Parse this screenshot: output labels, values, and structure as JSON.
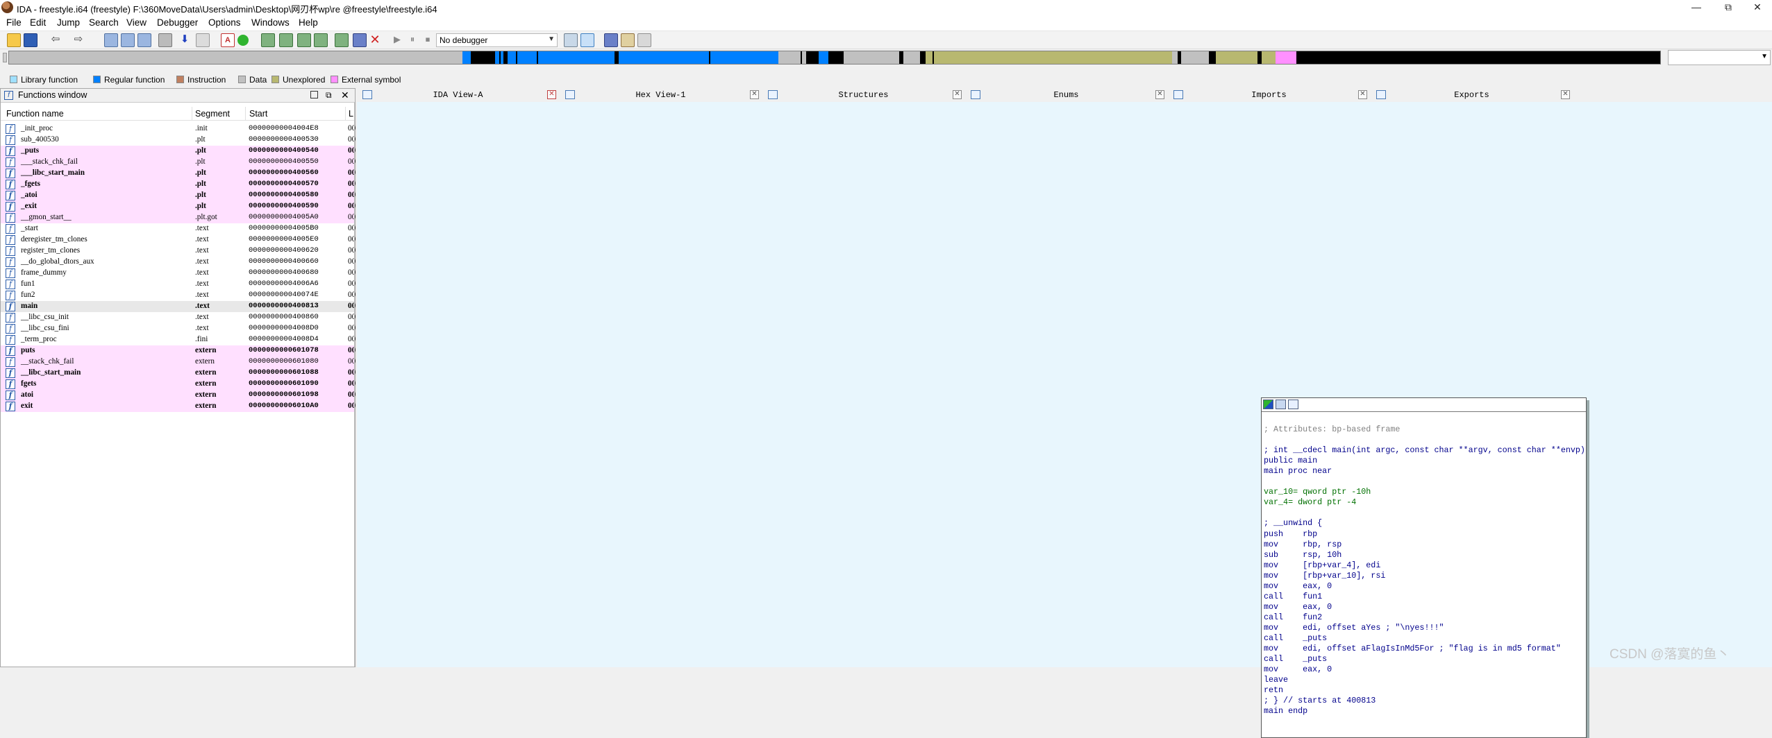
{
  "window": {
    "title": "IDA - freestyle.i64 (freestyle) F:\\360MoveData\\Users\\admin\\Desktop\\网刃杯wp\\re @freestyle\\freestyle.i64",
    "controls": [
      "—",
      "⧉",
      "✕"
    ]
  },
  "menu": [
    "File",
    "Edit",
    "Jump",
    "Search",
    "View",
    "Debugger",
    "Options",
    "Windows",
    "Help"
  ],
  "toolbar": {
    "debugger_select": "No debugger"
  },
  "legend": [
    {
      "label": "Library function",
      "color": "#a0e0ff"
    },
    {
      "label": "Regular function",
      "color": "#0080ff"
    },
    {
      "label": "Instruction",
      "color": "#c08060"
    },
    {
      "label": "Data",
      "color": "#c0c0c0"
    },
    {
      "label": "Unexplored",
      "color": "#b8b870"
    },
    {
      "label": "External symbol",
      "color": "#ff90ff"
    }
  ],
  "functions_window": {
    "title": "Functions window",
    "columns": [
      "Function name",
      "Segment",
      "Start",
      "L"
    ],
    "rows": [
      {
        "name": "_init_proc",
        "segment": ".init",
        "start": "00000000004004E8",
        "len": "00",
        "style": ""
      },
      {
        "name": "sub_400530",
        "segment": ".plt",
        "start": "0000000000400530",
        "len": "00",
        "style": ""
      },
      {
        "name": "_puts",
        "segment": ".plt",
        "start": "0000000000400540",
        "len": "00",
        "style": "pink bold"
      },
      {
        "name": "___stack_chk_fail",
        "segment": ".plt",
        "start": "0000000000400550",
        "len": "00",
        "style": "pink"
      },
      {
        "name": "___libc_start_main",
        "segment": ".plt",
        "start": "0000000000400560",
        "len": "00",
        "style": "pink bold"
      },
      {
        "name": "_fgets",
        "segment": ".plt",
        "start": "0000000000400570",
        "len": "00",
        "style": "pink bold"
      },
      {
        "name": "_atoi",
        "segment": ".plt",
        "start": "0000000000400580",
        "len": "00",
        "style": "pink bold"
      },
      {
        "name": "_exit",
        "segment": ".plt",
        "start": "0000000000400590",
        "len": "00",
        "style": "pink bold"
      },
      {
        "name": "__gmon_start__",
        "segment": ".plt.got",
        "start": "00000000004005A0",
        "len": "00",
        "style": "pink"
      },
      {
        "name": "_start",
        "segment": ".text",
        "start": "00000000004005B0",
        "len": "00",
        "style": ""
      },
      {
        "name": "deregister_tm_clones",
        "segment": ".text",
        "start": "00000000004005E0",
        "len": "00",
        "style": ""
      },
      {
        "name": "register_tm_clones",
        "segment": ".text",
        "start": "0000000000400620",
        "len": "00",
        "style": ""
      },
      {
        "name": "__do_global_dtors_aux",
        "segment": ".text",
        "start": "0000000000400660",
        "len": "00",
        "style": ""
      },
      {
        "name": "frame_dummy",
        "segment": ".text",
        "start": "0000000000400680",
        "len": "00",
        "style": ""
      },
      {
        "name": "fun1",
        "segment": ".text",
        "start": "00000000004006A6",
        "len": "00",
        "style": ""
      },
      {
        "name": "fun2",
        "segment": ".text",
        "start": "000000000040074E",
        "len": "00",
        "style": ""
      },
      {
        "name": "main",
        "segment": ".text",
        "start": "0000000000400813",
        "len": "00",
        "style": "sel bold"
      },
      {
        "name": "__libc_csu_init",
        "segment": ".text",
        "start": "0000000000400860",
        "len": "00",
        "style": ""
      },
      {
        "name": "__libc_csu_fini",
        "segment": ".text",
        "start": "00000000004008D0",
        "len": "00",
        "style": ""
      },
      {
        "name": "_term_proc",
        "segment": ".fini",
        "start": "00000000004008D4",
        "len": "00",
        "style": ""
      },
      {
        "name": "puts",
        "segment": "extern",
        "start": "0000000000601078",
        "len": "00",
        "style": "pink bold"
      },
      {
        "name": "__stack_chk_fail",
        "segment": "extern",
        "start": "0000000000601080",
        "len": "00",
        "style": "pink"
      },
      {
        "name": "__libc_start_main",
        "segment": "extern",
        "start": "0000000000601088",
        "len": "00",
        "style": "pink bold"
      },
      {
        "name": "fgets",
        "segment": "extern",
        "start": "0000000000601090",
        "len": "00",
        "style": "pink bold"
      },
      {
        "name": "atoi",
        "segment": "extern",
        "start": "0000000000601098",
        "len": "00",
        "style": "pink bold"
      },
      {
        "name": "exit",
        "segment": "extern",
        "start": "00000000006010A0",
        "len": "00",
        "style": "pink bold"
      }
    ]
  },
  "tabs": [
    {
      "label": "IDA View-A",
      "active": true
    },
    {
      "label": "Hex View-1",
      "active": false
    },
    {
      "label": "Structures",
      "active": false
    },
    {
      "label": "Enums",
      "active": false
    },
    {
      "label": "Imports",
      "active": false
    },
    {
      "label": "Exports",
      "active": false
    }
  ],
  "graph_node": {
    "lines": [
      {
        "t": "",
        "c": ""
      },
      {
        "t": "; Attributes: bp-based frame",
        "c": "cm"
      },
      {
        "t": "",
        "c": ""
      },
      {
        "t": "; int __cdecl main(int argc, const char **argv, const char **envp)",
        "c": ""
      },
      {
        "t": "public main",
        "c": ""
      },
      {
        "t": "main proc near",
        "c": ""
      },
      {
        "t": "",
        "c": ""
      },
      {
        "t": "var_10= qword ptr -10h",
        "c": "g"
      },
      {
        "t": "var_4= dword ptr -4",
        "c": "g"
      },
      {
        "t": "",
        "c": ""
      },
      {
        "t": "; __unwind {",
        "c": ""
      },
      {
        "t": "push    rbp",
        "c": ""
      },
      {
        "t": "mov     rbp, rsp",
        "c": ""
      },
      {
        "t": "sub     rsp, 10h",
        "c": ""
      },
      {
        "t": "mov     [rbp+var_4], edi",
        "c": ""
      },
      {
        "t": "mov     [rbp+var_10], rsi",
        "c": ""
      },
      {
        "t": "mov     eax, 0",
        "c": ""
      },
      {
        "t": "call    fun1",
        "c": ""
      },
      {
        "t": "mov     eax, 0",
        "c": ""
      },
      {
        "t": "call    fun2",
        "c": ""
      },
      {
        "t": "mov     edi, offset aYes ; \"\\nyes!!!\"",
        "c": ""
      },
      {
        "t": "call    _puts",
        "c": ""
      },
      {
        "t": "mov     edi, offset aFlagIsInMd5For ; \"flag is in md5 format\"",
        "c": ""
      },
      {
        "t": "call    _puts",
        "c": ""
      },
      {
        "t": "mov     eax, 0",
        "c": ""
      },
      {
        "t": "leave",
        "c": ""
      },
      {
        "t": "retn",
        "c": ""
      },
      {
        "t": "; } // starts at 400813",
        "c": ""
      },
      {
        "t": "main endp",
        "c": ""
      }
    ]
  },
  "watermark": "CSDN @落寞的鱼丶"
}
